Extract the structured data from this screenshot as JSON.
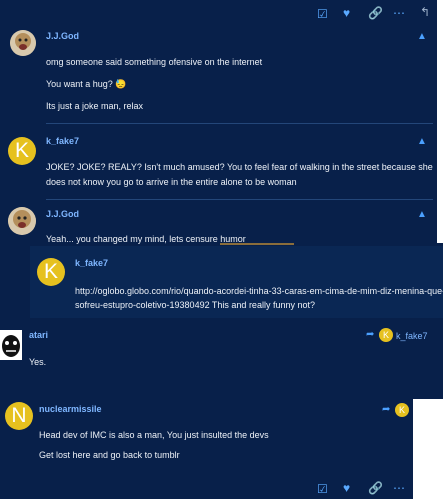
{
  "posts": [
    {
      "username": "J.J.God",
      "lines": [
        "omg someone said something ofensive on the internet",
        "You want a hug? 😓",
        "Its just a joke man, relax"
      ]
    },
    {
      "username": "k_fake7",
      "avatar_letter": "K",
      "lines": [
        "JOKE? JOKE? REALY? Isn't much amused? You to feel fear of walking in the street because she",
        "does not know you go to arrive in the entire alone to be woman"
      ]
    },
    {
      "username": "J.J.God",
      "lines": [
        "Yeah... you changed my mind, lets censure humor"
      ]
    },
    {
      "username": "k_fake7",
      "avatar_letter": "K",
      "lines": [
        "http://oglobo.globo.com/rio/quando-acordei-tinha-33-caras-em-cima-de-mim-diz-menina-que-",
        "sofreu-estupro-coletivo-19380492 This and really funny not?"
      ]
    },
    {
      "username": "atari",
      "reply_to": "k_fake7",
      "lines": [
        "Yes."
      ]
    },
    {
      "username": "nuclearmissile",
      "avatar_letter": "N",
      "lines": [
        "Head dev of IMC is also a man, You just insulted the devs",
        "Get lost here and go back to tumblr"
      ]
    }
  ],
  "mini_avatar_letter": "K"
}
